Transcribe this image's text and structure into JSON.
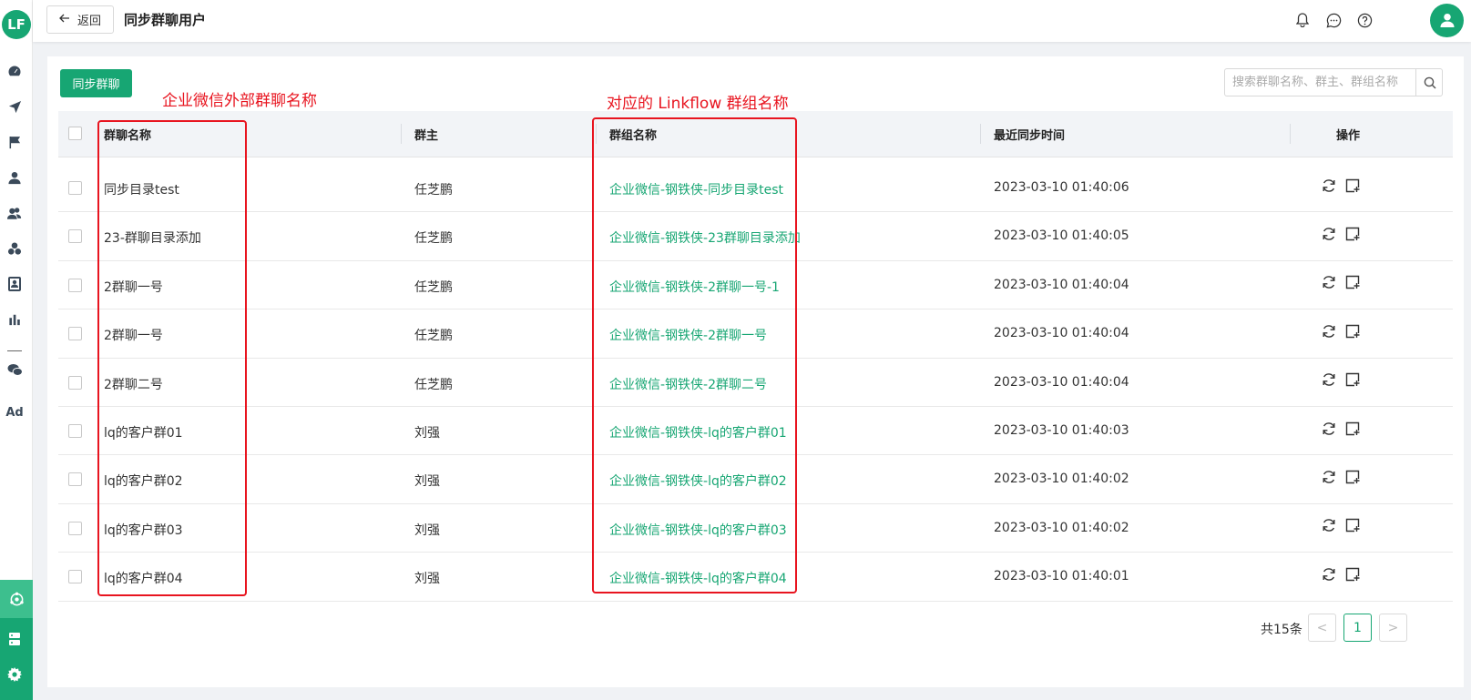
{
  "app": {
    "logo_text": "LF"
  },
  "header": {
    "back_label": "返回",
    "title": "同步群聊用户"
  },
  "toolbar": {
    "sync_label": "同步群聊",
    "search_placeholder": "搜索群聊名称、群主、群组名称"
  },
  "annotations": {
    "left": "企业微信外部群聊名称",
    "right": "对应的 Linkflow 群组名称"
  },
  "sidebar": {
    "ad_label": "Ad"
  },
  "table": {
    "columns": [
      "群聊名称",
      "群主",
      "群组名称",
      "最近同步时间",
      "操作"
    ],
    "rows": [
      {
        "name": "同步目录test",
        "owner": "任芝鹏",
        "group": "企业微信-钢铁侠-同步目录test",
        "time": "2023-03-10 01:40:06"
      },
      {
        "name": "23-群聊目录添加",
        "owner": "任芝鹏",
        "group": "企业微信-钢铁侠-23群聊目录添加",
        "time": "2023-03-10 01:40:05"
      },
      {
        "name": "2群聊一号",
        "owner": "任芝鹏",
        "group": "企业微信-钢铁侠-2群聊一号-1",
        "time": "2023-03-10 01:40:04"
      },
      {
        "name": "2群聊一号",
        "owner": "任芝鹏",
        "group": "企业微信-钢铁侠-2群聊一号",
        "time": "2023-03-10 01:40:04"
      },
      {
        "name": "2群聊二号",
        "owner": "任芝鹏",
        "group": "企业微信-钢铁侠-2群聊二号",
        "time": "2023-03-10 01:40:04"
      },
      {
        "name": "lq的客户群01",
        "owner": "刘强",
        "group": "企业微信-钢铁侠-lq的客户群01",
        "time": "2023-03-10 01:40:03"
      },
      {
        "name": "lq的客户群02",
        "owner": "刘强",
        "group": "企业微信-钢铁侠-lq的客户群02",
        "time": "2023-03-10 01:40:02"
      },
      {
        "name": "lq的客户群03",
        "owner": "刘强",
        "group": "企业微信-钢铁侠-lq的客户群03",
        "time": "2023-03-10 01:40:02"
      },
      {
        "name": "lq的客户群04",
        "owner": "刘强",
        "group": "企业微信-钢铁侠-lq的客户群04",
        "time": "2023-03-10 01:40:01"
      }
    ]
  },
  "pagination": {
    "total_label": "共15条",
    "current_page": "1",
    "prev": "<",
    "next": ">"
  },
  "colors": {
    "accent": "#17a673",
    "annotation": "#e8141f"
  }
}
